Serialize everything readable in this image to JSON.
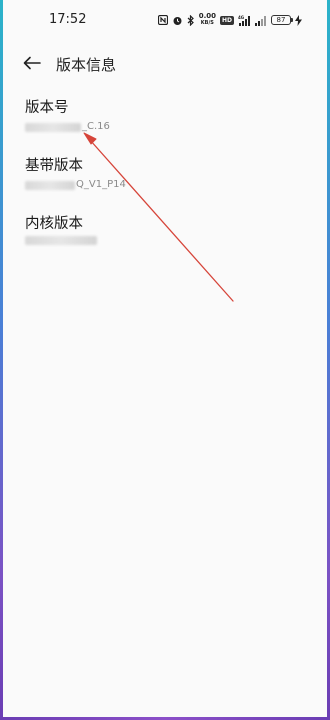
{
  "status_bar": {
    "time": "17:52",
    "net_speed_value": "0.00",
    "net_speed_unit": "KB/S",
    "hd_label": "HD",
    "battery_level": "87",
    "icons": [
      "nfc-icon",
      "alarm-icon",
      "bluetooth-icon",
      "hd-icon",
      "signal-4g-icon",
      "signal-icon",
      "battery-icon",
      "charging-icon"
    ]
  },
  "header": {
    "title": "版本信息",
    "back_icon": "back-arrow-icon"
  },
  "items": [
    {
      "label": "版本号",
      "value_visible": "_C.16"
    },
    {
      "label": "基带版本",
      "value_visible": "Q_V1_P14"
    },
    {
      "label": "内核版本",
      "value_visible": ""
    }
  ],
  "annotation": {
    "color": "#d6453a"
  },
  "colors": {
    "background": "#fafafa",
    "edge_gradient_top": "#2bb3c9",
    "edge_gradient_bottom": "#6a3db3"
  }
}
